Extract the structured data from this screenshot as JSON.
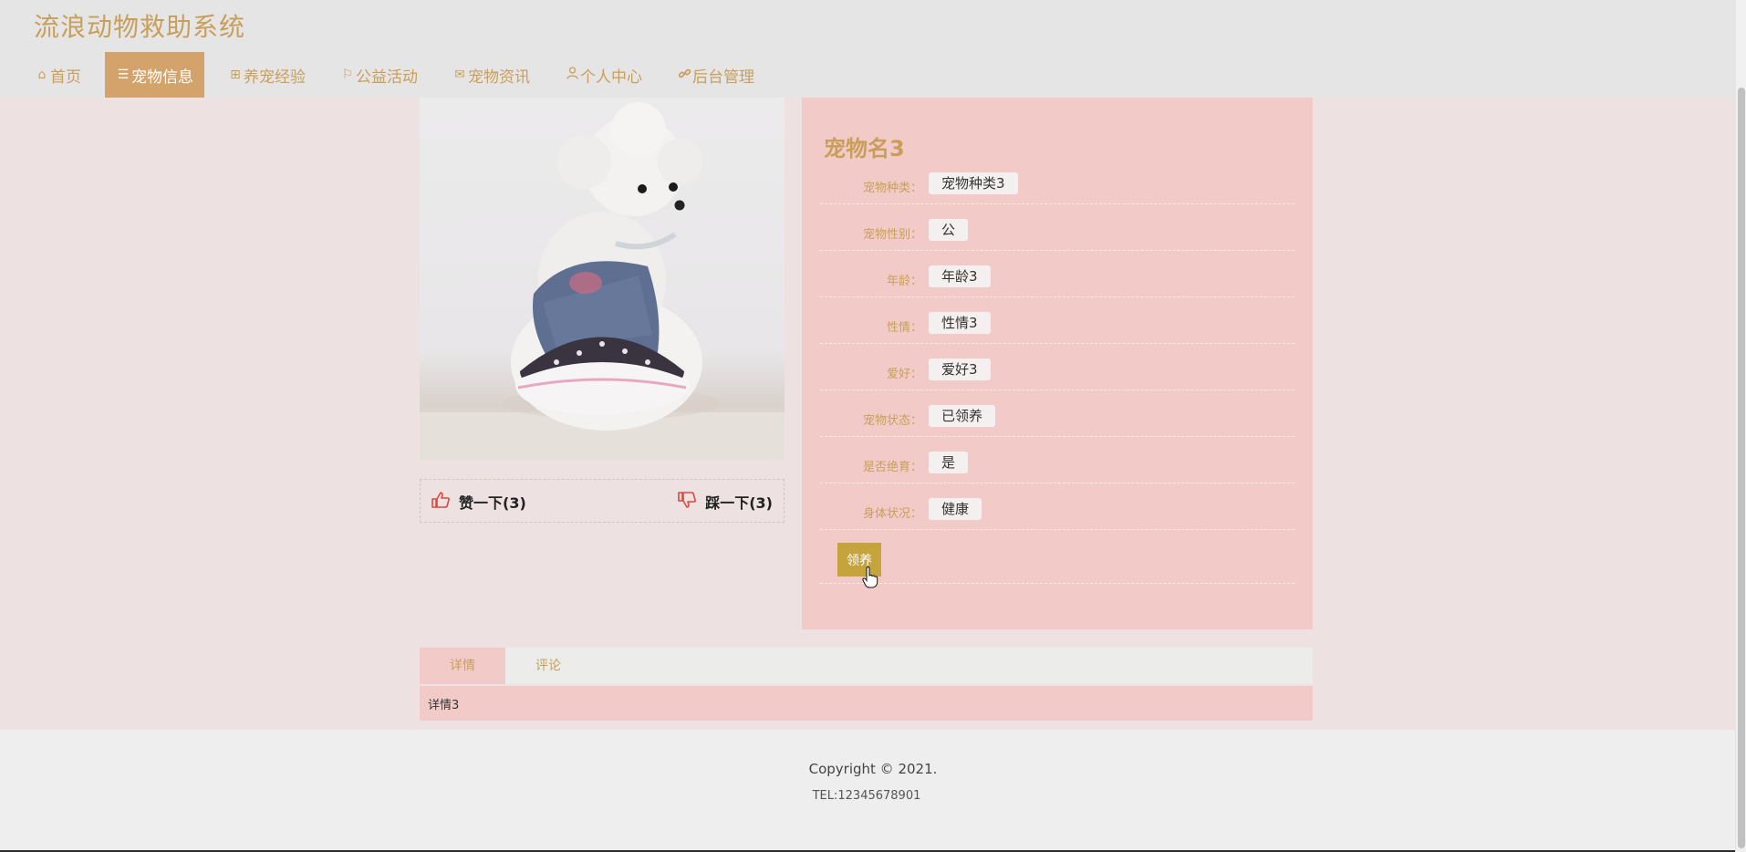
{
  "site": {
    "title": "流浪动物救助系统"
  },
  "nav": {
    "items": [
      {
        "label": "首页",
        "icon": "home-icon"
      },
      {
        "label": "宠物信息",
        "icon": "list-icon",
        "active": true
      },
      {
        "label": "养宠经验",
        "icon": "gift-icon"
      },
      {
        "label": "公益活动",
        "icon": "flag-icon"
      },
      {
        "label": "宠物资讯",
        "icon": "mail-icon"
      },
      {
        "label": "个人中心",
        "icon": "user-icon"
      },
      {
        "label": "后台管理",
        "icon": "link-icon"
      }
    ]
  },
  "pet": {
    "name": "宠物名3",
    "fields": [
      {
        "label": "宠物种类：",
        "value": "宠物种类3"
      },
      {
        "label": "宠物性别：",
        "value": "公"
      },
      {
        "label": "年龄：",
        "value": "年龄3"
      },
      {
        "label": "性情：",
        "value": "性情3"
      },
      {
        "label": "爱好：",
        "value": "爱好3"
      },
      {
        "label": "宠物状态：",
        "value": "已领养"
      },
      {
        "label": "是否绝育：",
        "value": "是"
      },
      {
        "label": "身体状况：",
        "value": "健康"
      }
    ],
    "adopt_label": "领养"
  },
  "votes": {
    "like_label": "赞一下(3)",
    "dislike_label": "踩一下(3)",
    "like_icon": "thumbs-up-icon",
    "dislike_icon": "thumbs-down-icon",
    "color": "#e2463d"
  },
  "tabs": {
    "items": [
      {
        "label": "详情",
        "active": true
      },
      {
        "label": "评论"
      }
    ],
    "content": "详情3"
  },
  "footer": {
    "copyright": "Copyright © 2021.",
    "tel": "TEL:12345678901"
  },
  "colors": {
    "accent": "#c89f5a",
    "nav_active_bg": "#d4a36b",
    "info_panel_bg": "#f2cbc8",
    "adopt_button_bg": "#c5a33d"
  }
}
